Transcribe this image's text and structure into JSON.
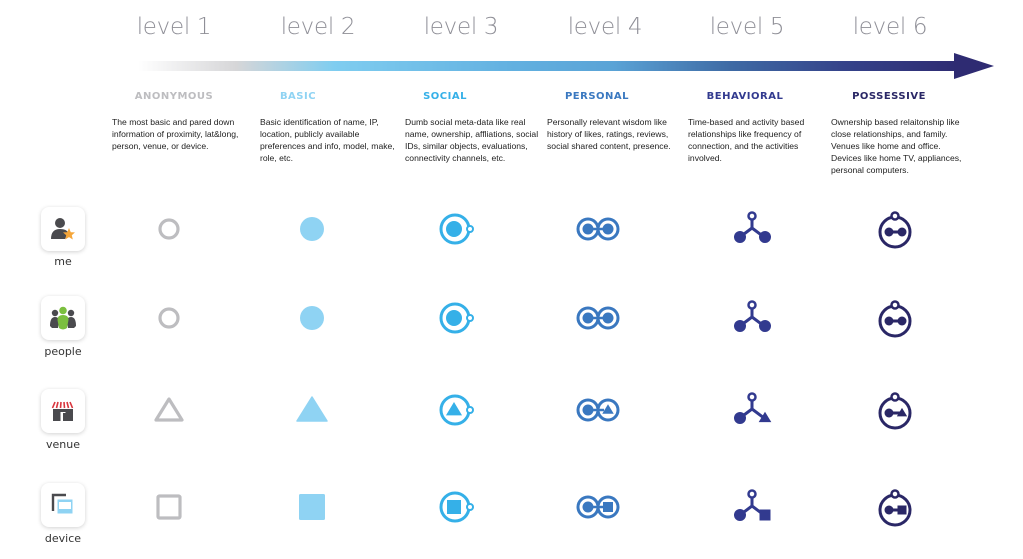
{
  "levels": [
    {
      "label": "level 1",
      "category": "ANONYMOUS",
      "color": "#bdbdc0",
      "description": "The most basic and pared down information of proximity, lat&long, person, venue, or device."
    },
    {
      "label": "level 2",
      "category": "BASIC",
      "color": "#8fd3f3",
      "description": "Basic identification of name, IP, location, publicly available preferences and info, model, make, role, etc."
    },
    {
      "label": "level 3",
      "category": "SOCIAL",
      "color": "#35b0e8",
      "description": "Dumb social meta-data like real name, ownership, affliations, social IDs, similar objects, evaluations, connectivity channels, etc."
    },
    {
      "label": "level 4",
      "category": "PERSONAL",
      "color": "#3a78c0",
      "description": "Personally relevant wisdom like history of likes, ratings, reviews, social shared content, presence."
    },
    {
      "label": "level 5",
      "category": "BEHAVIORAL",
      "color": "#323a8f",
      "description": "Time-based and activity based relationships like frequency of connection, and the activities involved."
    },
    {
      "label": "level 6",
      "category": "POSSESSIVE",
      "color": "#2a2766",
      "description": "Ownership based relaitonship like close relationships, and family. Venues like home and office. Devices like home TV, appliances, personal computers."
    }
  ],
  "rows": [
    {
      "label": "me",
      "icon": "person-star-icon",
      "shape": "circle"
    },
    {
      "label": "people",
      "icon": "group-icon",
      "shape": "circle"
    },
    {
      "label": "venue",
      "icon": "storefront-icon",
      "shape": "triangle"
    },
    {
      "label": "device",
      "icon": "device-icon",
      "shape": "square"
    }
  ],
  "colors": {
    "level_text": "#8f8f97",
    "icon_dark": "#4a4a4e",
    "star": "#f5a63a",
    "people_green": "#7bbf3f",
    "awning_red": "#d9363e",
    "device_blue": "#8fd3f3"
  }
}
